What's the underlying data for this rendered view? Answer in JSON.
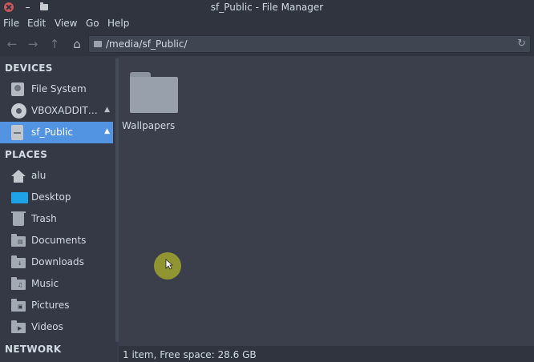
{
  "window": {
    "title": "sf_Public - File Manager"
  },
  "menu": [
    "File",
    "Edit",
    "View",
    "Go",
    "Help"
  ],
  "toolbar": {
    "path": "/media/sf_Public/"
  },
  "sidebar": {
    "devices_header": "DEVICES",
    "devices": [
      {
        "label": "File System",
        "icon": "harddisk-icon"
      },
      {
        "label": "VBOXADDIT…",
        "icon": "optical-disc-icon",
        "eject": true
      },
      {
        "label": "sf_Public",
        "icon": "usb-drive-icon",
        "eject": true,
        "selected": true
      }
    ],
    "places_header": "PLACES",
    "places": [
      {
        "label": "alu",
        "icon": "home-icon"
      },
      {
        "label": "Desktop",
        "icon": "desktop-icon"
      },
      {
        "label": "Trash",
        "icon": "trash-icon"
      },
      {
        "label": "Documents",
        "icon": "documents-folder-icon"
      },
      {
        "label": "Downloads",
        "icon": "downloads-folder-icon"
      },
      {
        "label": "Music",
        "icon": "music-folder-icon"
      },
      {
        "label": "Pictures",
        "icon": "pictures-folder-icon"
      },
      {
        "label": "Videos",
        "icon": "videos-folder-icon"
      }
    ],
    "network_header": "NETWORK"
  },
  "main": {
    "items": [
      {
        "name": "Wallpapers",
        "icon": "folder-icon"
      }
    ]
  },
  "status": {
    "text": "1 item, Free space: 28.6 GB"
  },
  "colors": {
    "accent": "#5294e2",
    "background": "#383c4a",
    "chrome": "#2f343f",
    "cursor_highlight": "#d7dc1e"
  }
}
